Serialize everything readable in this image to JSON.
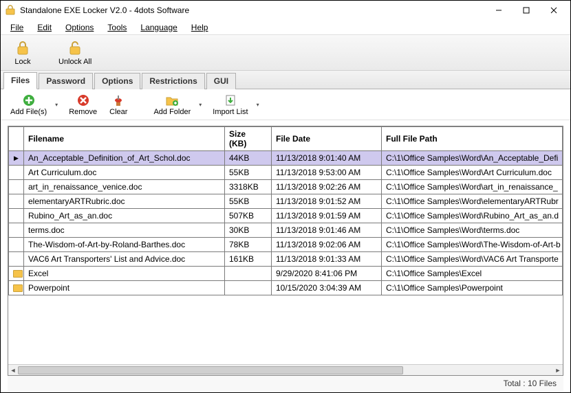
{
  "window": {
    "title": "Standalone EXE Locker V2.0 - 4dots Software"
  },
  "menu": {
    "file": "File",
    "edit": "Edit",
    "options": "Options",
    "tools": "Tools",
    "language": "Language",
    "help": "Help"
  },
  "main_toolbar": {
    "lock": "Lock",
    "unlock_all": "Unlock All"
  },
  "tabs": {
    "files": "Files",
    "password": "Password",
    "options": "Options",
    "restrictions": "Restrictions",
    "gui": "GUI"
  },
  "tab_toolbar": {
    "add_files": "Add File(s)",
    "remove": "Remove",
    "clear": "Clear",
    "add_folder": "Add Folder",
    "import_list": "Import List"
  },
  "columns": {
    "filename": "Filename",
    "size": "Size",
    "size_sub": "(KB)",
    "file_date": "File Date",
    "full_path": "Full File Path"
  },
  "rows": [
    {
      "type": "file",
      "sel": true,
      "filename": "An_Acceptable_Definition_of_Art_Schol.doc",
      "size": "44KB",
      "date": "11/13/2018 9:01:40 AM",
      "path": "C:\\1\\Office Samples\\Word\\An_Acceptable_Defi"
    },
    {
      "type": "file",
      "filename": "Art Curriculum.doc",
      "size": "55KB",
      "date": "11/13/2018 9:53:00 AM",
      "path": "C:\\1\\Office Samples\\Word\\Art Curriculum.doc"
    },
    {
      "type": "file",
      "filename": "art_in_renaissance_venice.doc",
      "size": "3318KB",
      "date": "11/13/2018 9:02:26 AM",
      "path": "C:\\1\\Office Samples\\Word\\art_in_renaissance_"
    },
    {
      "type": "file",
      "filename": "elementaryARTRubric.doc",
      "size": "55KB",
      "date": "11/13/2018 9:01:52 AM",
      "path": "C:\\1\\Office Samples\\Word\\elementaryARTRubr"
    },
    {
      "type": "file",
      "filename": "Rubino_Art_as_an.doc",
      "size": "507KB",
      "date": "11/13/2018 9:01:59 AM",
      "path": "C:\\1\\Office Samples\\Word\\Rubino_Art_as_an.d"
    },
    {
      "type": "file",
      "filename": "terms.doc",
      "size": "30KB",
      "date": "11/13/2018 9:01:46 AM",
      "path": "C:\\1\\Office Samples\\Word\\terms.doc"
    },
    {
      "type": "file",
      "filename": "The-Wisdom-of-Art-by-Roland-Barthes.doc",
      "size": "78KB",
      "date": "11/13/2018 9:02:06 AM",
      "path": "C:\\1\\Office Samples\\Word\\The-Wisdom-of-Art-b"
    },
    {
      "type": "file",
      "filename": "VAC6 Art Transporters' List and Advice.doc",
      "size": "161KB",
      "date": "11/13/2018 9:01:33 AM",
      "path": "C:\\1\\Office Samples\\Word\\VAC6 Art Transporte"
    },
    {
      "type": "folder",
      "filename": "Excel",
      "size": "",
      "date": "9/29/2020 8:41:06 PM",
      "path": "C:\\1\\Office Samples\\Excel"
    },
    {
      "type": "folder",
      "filename": "Powerpoint",
      "size": "",
      "date": "10/15/2020 3:04:39 AM",
      "path": "C:\\1\\Office Samples\\Powerpoint"
    }
  ],
  "status": {
    "total": "Total : 10 Files"
  }
}
